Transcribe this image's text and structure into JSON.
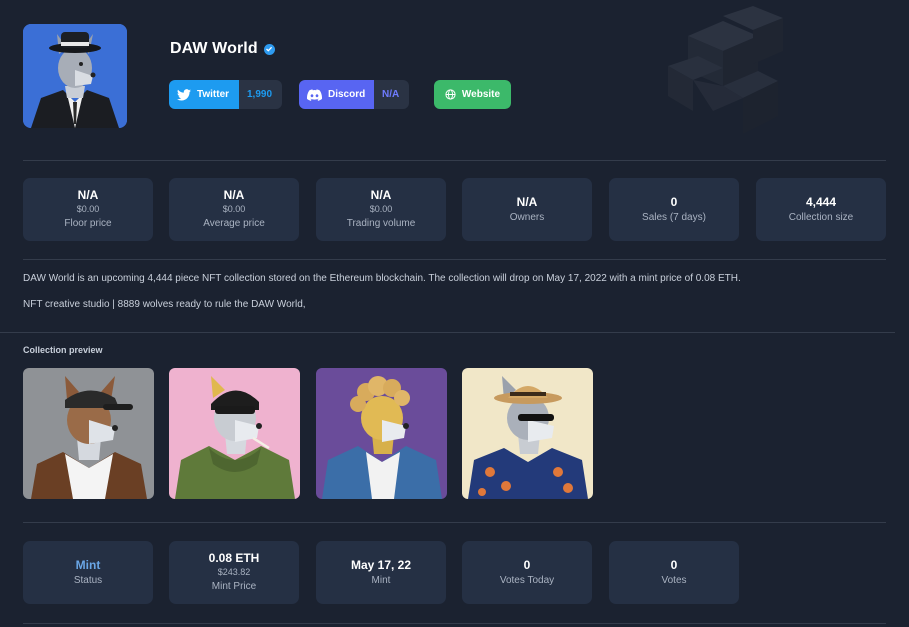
{
  "collection": {
    "name": "DAW World",
    "verified": true
  },
  "social": {
    "twitter": {
      "label": "Twitter",
      "count": "1,990",
      "color": "#1d9bf0"
    },
    "discord": {
      "label": "Discord",
      "count": "N/A",
      "color": "#5865f2"
    },
    "website": {
      "label": "Website",
      "color": "#3cb96a"
    }
  },
  "stats": [
    {
      "value": "N/A",
      "usd": "$0.00",
      "label": "Floor price"
    },
    {
      "value": "N/A",
      "usd": "$0.00",
      "label": "Average price"
    },
    {
      "value": "N/A",
      "usd": "$0.00",
      "label": "Trading volume"
    },
    {
      "value": "N/A",
      "label": "Owners"
    },
    {
      "value": "0",
      "label": "Sales (7 days)"
    },
    {
      "value": "4,444",
      "label": "Collection size"
    }
  ],
  "description": {
    "line1": "DAW World is an upcoming 4,444 piece NFT collection stored on the Ethereum blockchain. The collection will drop on May 17, 2022 with a mint price of 0.08 ETH.",
    "line2": "NFT creative studio | 8889 wolves ready to rule the DAW World,"
  },
  "preview": {
    "title": "Collection preview",
    "images": [
      {
        "name": "wolf-cap-tanktop",
        "bg": "#8f9296"
      },
      {
        "name": "wolf-beanie-hoodie",
        "bg": "#efb2cf"
      },
      {
        "name": "wolf-curly-denim",
        "bg": "#6a4c9a"
      },
      {
        "name": "wolf-hat-shades",
        "bg": "#f1e7c8"
      }
    ]
  },
  "mint_stats": [
    {
      "value": "Mint",
      "label": "Status",
      "accent": true
    },
    {
      "value": "0.08 ETH",
      "usd": "$243.82",
      "label": "Mint Price"
    },
    {
      "value": "May 17, 22",
      "label": "Mint"
    },
    {
      "value": "0",
      "label": "Votes Today"
    },
    {
      "value": "0",
      "label": "Votes"
    }
  ],
  "icons": {
    "verified": "verified-badge-icon",
    "twitter": "twitter-bird-icon",
    "discord": "discord-logo-icon",
    "website": "globe-icon"
  }
}
